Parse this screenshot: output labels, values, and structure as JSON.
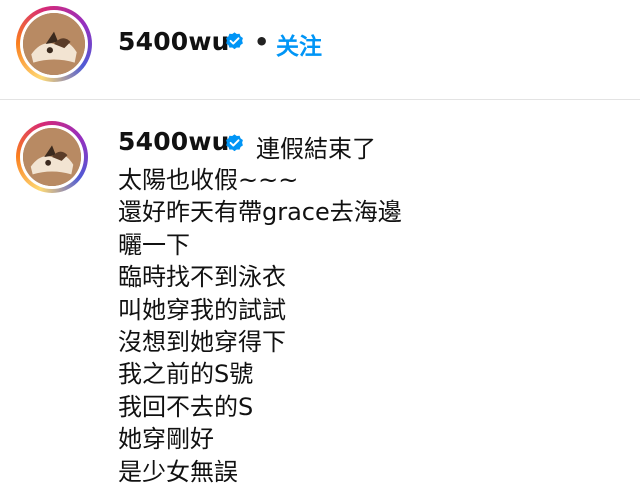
{
  "header": {
    "username": "5400wu",
    "verified_icon": "verified-badge-icon",
    "separator": "•",
    "follow_label": "关注"
  },
  "post": {
    "username": "5400wu",
    "verified_icon": "verified-badge-icon",
    "caption_first_line": "連假結束了",
    "caption_lines": [
      "太陽也收假~~~",
      "還好昨天有帶grace去海邊",
      "曬一下",
      "臨時找不到泳衣",
      "叫她穿我的試試",
      "沒想到她穿得下",
      "我之前的S號",
      "我回不去的S",
      "她穿剛好",
      "是少女無誤"
    ]
  },
  "colors": {
    "follow_blue": "#0095f6",
    "verified_blue": "#0095f6",
    "ring_gradient": [
      "#feda75",
      "#fa7e1e",
      "#d62976",
      "#962fbf",
      "#4f5bd5"
    ]
  }
}
